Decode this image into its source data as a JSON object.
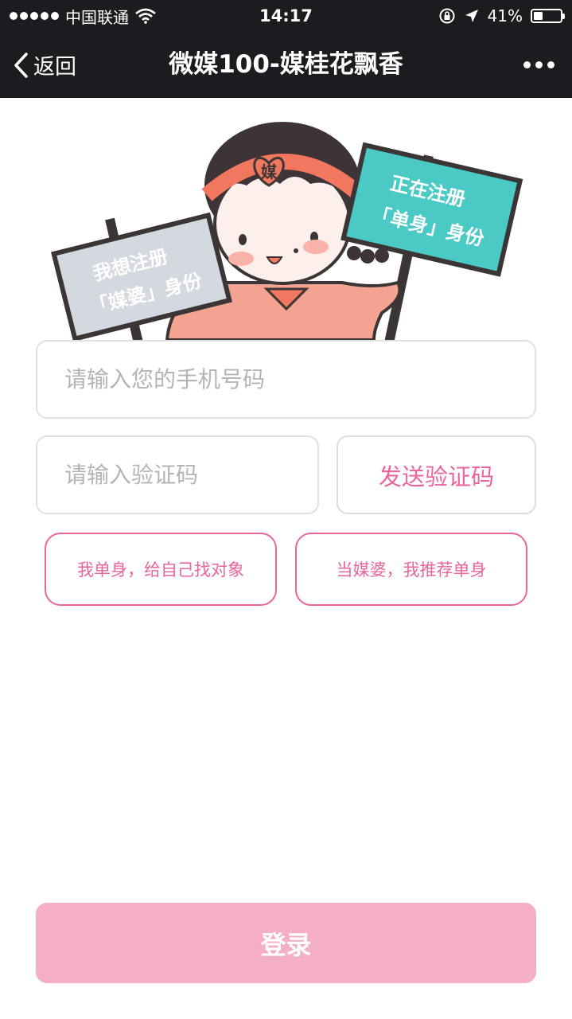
{
  "status_bar": {
    "carrier": "中国联通",
    "time": "14:17",
    "battery_percent": "41%",
    "battery_level": 0.41,
    "icons": [
      "signal-dots-icon",
      "wifi-icon",
      "rotation-lock-icon",
      "location-arrow-icon",
      "battery-icon"
    ]
  },
  "nav": {
    "back_label": "返回",
    "title": "微媒100-媒桂花飘香",
    "more_icon": "more-dots-icon"
  },
  "illustration": {
    "head_badge": "媒",
    "left_sign": [
      "我想注册",
      "「媒婆」身份"
    ],
    "right_sign": [
      "正在注册",
      "「单身」身份"
    ]
  },
  "form": {
    "phone_placeholder": "请输入您的手机号码",
    "code_placeholder": "请输入验证码",
    "send_code_label": "发送验证码",
    "role_single_label": "我单身，给自己找对象",
    "role_match_label": "当媒婆，我推荐单身",
    "login_label": "登录"
  },
  "colors": {
    "bar_background": "#1c1c20",
    "accent_pink": "#e8669a",
    "login_pink": "#f4aec6",
    "sign_gray": "#d4d8df",
    "sign_teal": "#4bc9c5"
  }
}
